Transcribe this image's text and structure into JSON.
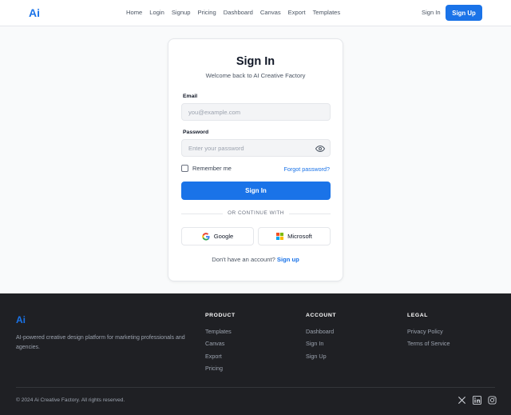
{
  "header": {
    "logo": "Ai",
    "nav": [
      "Home",
      "Login",
      "Signup",
      "Pricing",
      "Dashboard",
      "Canvas",
      "Export",
      "Templates"
    ],
    "signin": "Sign In",
    "signup": "Sign Up"
  },
  "form": {
    "title": "Sign In",
    "subtitle": "Welcome back to AI Creative Factory",
    "email_label": "Email",
    "email_placeholder": "you@example.com",
    "password_label": "Password",
    "password_placeholder": "Enter your password",
    "remember": "Remember me",
    "forgot": "Forgot password?",
    "submit": "Sign In",
    "divider": "OR CONTINUE WITH",
    "google": "Google",
    "microsoft": "Microsoft",
    "no_account": "Don't have an account?",
    "signup_link": "Sign up"
  },
  "footer": {
    "logo": "Ai",
    "description": "AI-powered creative design platform for marketing professionals and agencies.",
    "columns": [
      {
        "heading": "PRODUCT",
        "items": [
          "Templates",
          "Canvas",
          "Export",
          "Pricing"
        ]
      },
      {
        "heading": "ACCOUNT",
        "items": [
          "Dashboard",
          "Sign In",
          "Sign Up"
        ]
      },
      {
        "heading": "LEGAL",
        "items": [
          "Privacy Policy",
          "Terms of Service"
        ]
      }
    ],
    "copyright": "© 2024 Ai Creative Factory. All rights reserved.",
    "social_icons": [
      "x-icon",
      "linkedin-icon",
      "instagram-icon"
    ]
  },
  "colors": {
    "accent": "#1a73e8",
    "footer_bg": "#1f2024"
  }
}
